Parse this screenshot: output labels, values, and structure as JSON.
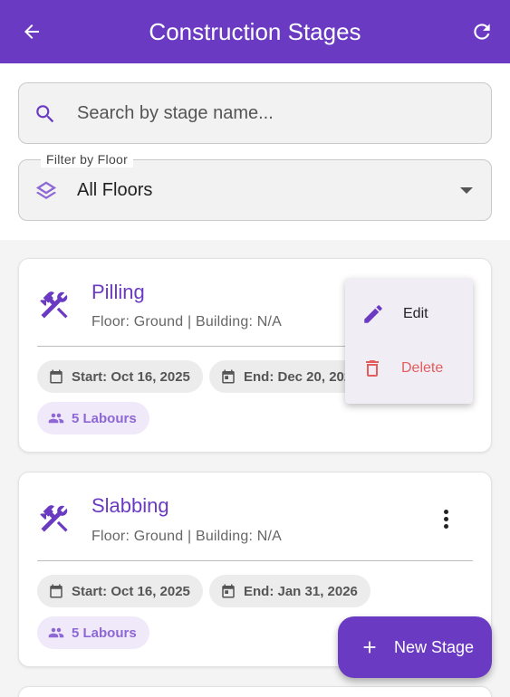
{
  "appbar": {
    "title": "Construction Stages",
    "back_icon": "arrow-back-icon",
    "refresh_icon": "refresh-icon"
  },
  "search": {
    "placeholder": "Search by stage name...",
    "value": ""
  },
  "filter": {
    "label": "Filter by Floor",
    "value": "All Floors"
  },
  "stages": [
    {
      "name": "Pilling",
      "meta": "Floor: Ground | Building: N/A",
      "start": "Start: Oct 16, 2025",
      "end": "End: Dec 20, 2025",
      "labours": "5 Labours"
    },
    {
      "name": "Slabbing",
      "meta": "Floor: Ground | Building: N/A",
      "start": "Start: Oct 16, 2025",
      "end": "End: Jan 31, 2026",
      "labours": "5 Labours"
    }
  ],
  "menu": {
    "edit": "Edit",
    "delete": "Delete"
  },
  "fab": {
    "label": "New Stage"
  },
  "colors": {
    "primary": "#6a3bc2",
    "danger": "#e35d5d",
    "chip_labour_bg": "#f0e9fa"
  }
}
